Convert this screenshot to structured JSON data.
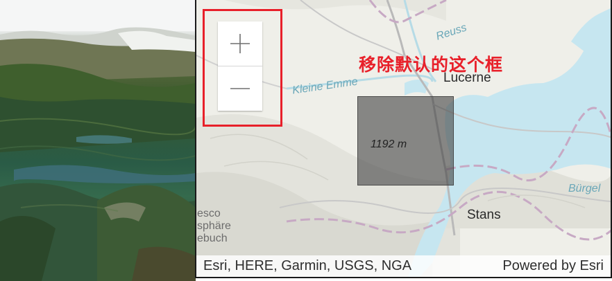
{
  "scene_view": {
    "description_icon": "terrain-3d"
  },
  "map_view": {
    "labels": {
      "reuss": "Reuss",
      "kleine_emme": "Kleine Emme",
      "lucerne": "Lucerne",
      "stans": "Stans",
      "burgen": "Bürgel",
      "park_1": "esco",
      "park_2": "sphäre",
      "park_3": "ebuch"
    },
    "overview": {
      "elevation": "1192 m"
    },
    "zoom": {
      "in_icon": "plus-icon",
      "out_icon": "minus-icon"
    },
    "annotation": "移除默认的这个框",
    "attribution": {
      "sources": "Esri, HERE, Garmin, USGS, NGA",
      "powered": "Powered by Esri"
    }
  },
  "colors": {
    "water": "#c6e6f0",
    "highlight": "#e8202a",
    "map_bg": "#efefe9"
  }
}
